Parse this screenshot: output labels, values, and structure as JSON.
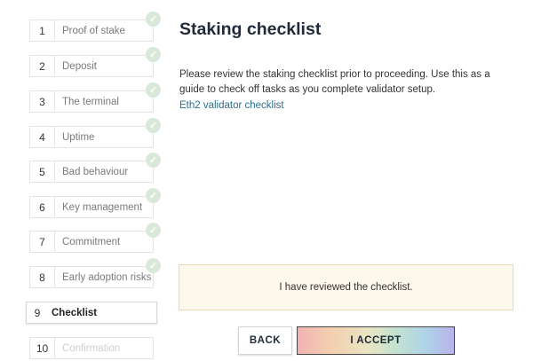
{
  "steps": [
    {
      "num": "1",
      "label": "Proof of stake"
    },
    {
      "num": "2",
      "label": "Deposit"
    },
    {
      "num": "3",
      "label": "The terminal"
    },
    {
      "num": "4",
      "label": "Uptime"
    },
    {
      "num": "5",
      "label": "Bad behaviour"
    },
    {
      "num": "6",
      "label": "Key management"
    },
    {
      "num": "7",
      "label": "Commitment"
    },
    {
      "num": "8",
      "label": "Early adoption risks"
    },
    {
      "num": "9",
      "label": "Checklist"
    },
    {
      "num": "10",
      "label": "Confirmation"
    }
  ],
  "check_glyph": "✓",
  "colors": {
    "completed_check": "#d9e9d9",
    "link": "#2a6f8a",
    "confirm_bg": "#fdf7ec"
  },
  "main": {
    "title": "Staking checklist",
    "description": "Please review the staking checklist prior to proceeding. Use this as a guide to check off tasks as you complete validator setup.",
    "link_text": "Eth2 validator checklist",
    "confirm_text": "I have reviewed the checklist."
  },
  "buttons": {
    "back": "BACK",
    "accept": "I ACCEPT"
  }
}
